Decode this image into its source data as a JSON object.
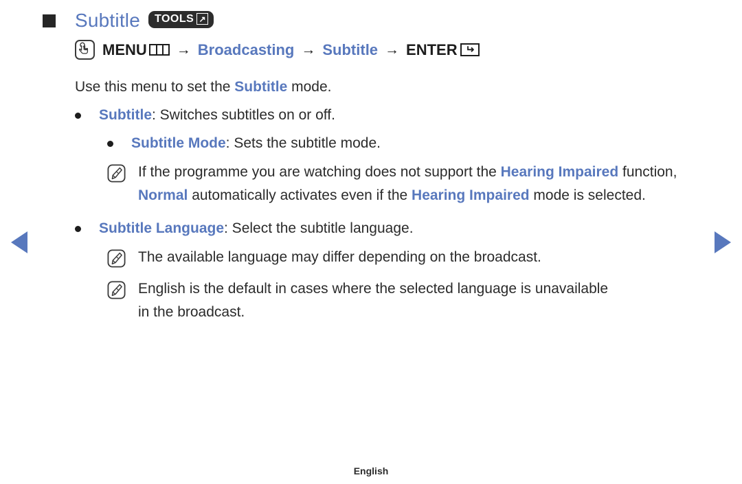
{
  "nav": {
    "prev_label": "Previous page",
    "next_label": "Next page"
  },
  "header": {
    "title": "Subtitle",
    "badge_label": "TOOLS",
    "badge_icon": "arrow-in-box-icon"
  },
  "menu_path": {
    "press_icon": "hand-press-icon",
    "menu_label": "MENU",
    "menu_icon": "menu-grid-icon",
    "sep1": "→",
    "step1": "Broadcasting",
    "sep2": "→",
    "step2": "Subtitle",
    "sep3": "→",
    "enter_label": "ENTER",
    "enter_icon": "enter-return-icon"
  },
  "body": {
    "lead": {
      "before": "Use this menu to set the ",
      "term": "Subtitle",
      "after": " mode."
    },
    "bullets": [
      {
        "term": "Subtitle",
        "desc": ": Switches subtitles on or off."
      },
      {
        "term": "Subtitle Mode",
        "desc": ": Sets the subtitle mode."
      },
      {
        "term": "Subtitle Language",
        "desc": ": Select the subtitle language."
      }
    ],
    "note_1": {
      "icon": "note-pencil-icon",
      "p1": "If the programme you are watching does not support the ",
      "t1": "Hearing Impaired",
      "p2": " function, ",
      "t2": "Normal",
      "p3": " automatically activates even if the ",
      "t3": "Hearing Impaired",
      "p4": " mode is selected."
    },
    "note_2": {
      "icon": "note-pencil-icon",
      "text": "The available language may differ depending on the broadcast."
    },
    "note_3": {
      "icon": "note-pencil-icon",
      "text": "English is the default in cases where the selected language is unavailable in the broadcast."
    }
  },
  "footer": {
    "language": "English"
  },
  "colors": {
    "accent_blue": "#5878bd",
    "text_dark": "#2b2b2b",
    "badge_bg": "#2d2d2d"
  }
}
